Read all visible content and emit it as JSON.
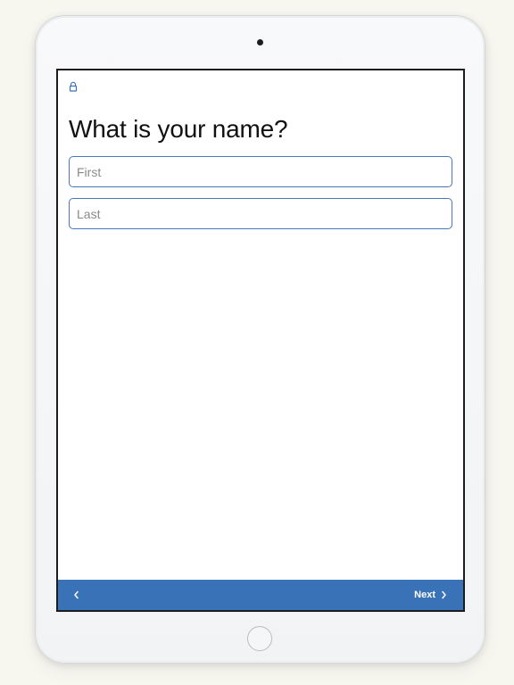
{
  "form": {
    "question": "What is your name?",
    "first_placeholder": "First",
    "first_value": "",
    "last_placeholder": "Last",
    "last_value": ""
  },
  "bottom_bar": {
    "next_label": "Next",
    "background_color": "#3a72b8"
  },
  "colors": {
    "accent": "#3a72b8",
    "field_border": "#4a76bb"
  },
  "icons": {
    "lock": "lock-icon",
    "back": "chevron-left-icon",
    "next": "chevron-right-icon"
  }
}
